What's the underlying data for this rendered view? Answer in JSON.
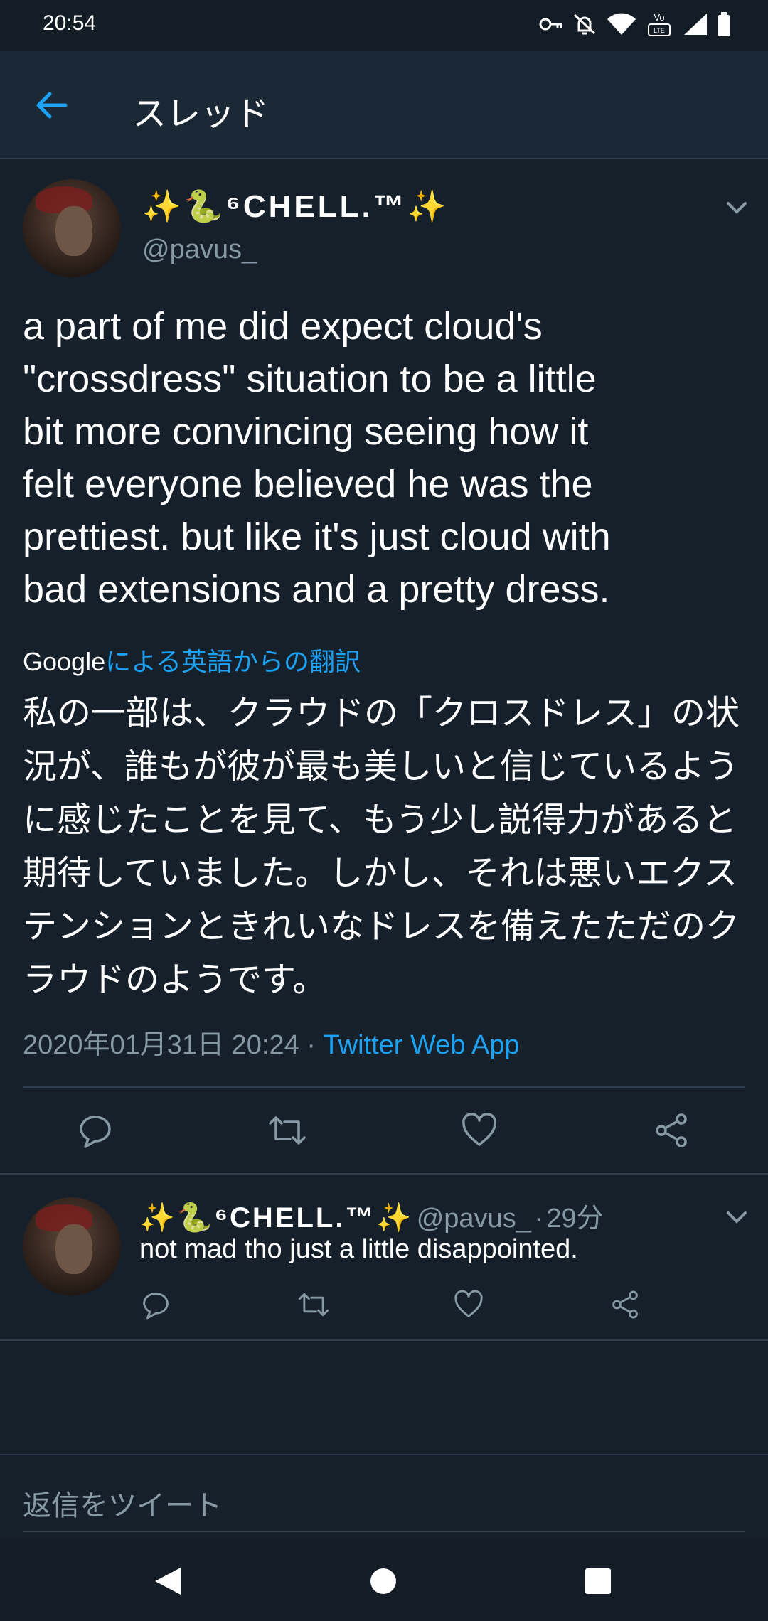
{
  "status_bar": {
    "time": "20:54",
    "icons": [
      "key-icon",
      "bell-off-icon",
      "wifi-icon",
      "volte-icon",
      "signal-icon",
      "battery-icon"
    ],
    "volte_label": "VoLTE"
  },
  "app_bar": {
    "title": "スレッド",
    "back_icon": "arrow-left-icon"
  },
  "main_tweet": {
    "display_name": "✨🐍⁶CHELL.™✨",
    "handle": "@pavus_",
    "text": "a part of me did expect cloud's\n\"crossdress\" situation to be a little\nbit more convincing seeing how it\nfelt everyone believed he was the\nprettiest. but like it's just cloud with\nbad extensions and a pretty dress.",
    "translation_provider": "Google",
    "translation_label": "による英語からの翻訳",
    "translated_text": "私の一部は、クラウドの「クロスドレス」の状\n況が、誰もが彼が最も美しいと信じているよう\nに感じたことを見て、もう少し説得力があると\n期待していました。しかし、それは悪いエクス\nテンションときれいなドレスを備えたただのク\nラウドのようです。",
    "timestamp": "2020年01月31日 20:24",
    "separator": "·",
    "source_app": "Twitter Web App",
    "actions": [
      "reply-icon",
      "retweet-icon",
      "like-icon",
      "share-icon"
    ]
  },
  "reply_tweet": {
    "display_name": "✨🐍⁶CHELL.™✨",
    "handle": "@pavus_",
    "separator": "·",
    "time": "29分",
    "text": "not mad tho just a little disappointed.",
    "actions": [
      "reply-icon",
      "retweet-icon",
      "like-icon",
      "share-icon"
    ]
  },
  "compose": {
    "placeholder": "返信をツイート"
  },
  "nav_bar": {
    "buttons": [
      "back-triangle-icon",
      "home-circle-icon",
      "recents-square-icon"
    ]
  },
  "colors": {
    "background": "#15202b",
    "accent": "#1da1f2",
    "secondary_text": "#8899a6"
  }
}
